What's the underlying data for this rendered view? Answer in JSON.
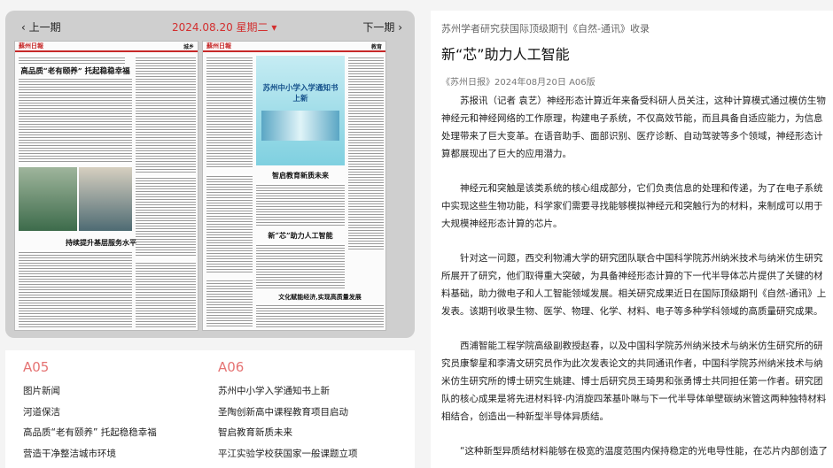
{
  "nav": {
    "prev": "上一期",
    "date": "2024.08.20 星期二 ▾",
    "next": "下一期",
    "prev_arrow": "‹",
    "next_arrow": "›"
  },
  "thumb_left": {
    "logo": "蘇州日報",
    "section": "城乡",
    "headline1": "高品质“老有颐养” 托起稳稳幸福",
    "headline2": "持续提升基层服务水平"
  },
  "thumb_right": {
    "logo": "蘇州日報",
    "section": "教育",
    "banner": "苏州中小学入学通知书上新",
    "headline1": "智启教育新质未来",
    "headline2": "新“芯”助力人工智能",
    "headline3": "文化赋能经济,实现高质量发展"
  },
  "issues": {
    "a05": {
      "page": "A05",
      "items": [
        "图片新闻",
        "河道保洁",
        "高品质“老有颐养” 托起稳稳幸福",
        "营造干净整洁城市环境"
      ]
    },
    "a06": {
      "page": "A06",
      "items": [
        "苏州中小学入学通知书上新",
        "圣陶创新高中课程教育项目启动",
        "智启教育新质未来",
        "平江实验学校获国家一般课题立项"
      ]
    }
  },
  "article": {
    "subtitle": "苏州学者研究获国际顶级期刊《自然-通讯》收录",
    "title": "新“芯”助力人工智能",
    "source": "《苏州日报》2024年08月20日 A06版",
    "paragraphs": [
      "苏报讯（记者 袁艺）神经形态计算近年来备受科研人员关注，这种计算模式通过模仿生物神经元和神经网络的工作原理，构建电子系统，不仅高效节能，而且具备自适应能力，为信息处理带来了巨大变革。在语音助手、面部识别、医疗诊断、自动驾驶等多个领域，神经形态计算都展现出了巨大的应用潜力。",
      "神经元和突触是该类系统的核心组成部分，它们负责信息的处理和传递，为了在电子系统中实现这些生物功能，科学家们需要寻找能够模拟神经元和突触行为的材料，来制成可以用于大规模神经形态计算的芯片。",
      "针对这一问题，西交利物浦大学的研究团队联合中国科学院苏州纳米技术与纳米仿生研究所展开了研究，他们取得重大突破，为具备神经形态计算的下一代半导体芯片提供了关键的材料基础，助力微电子和人工智能领域发展。相关研究成果近日在国际顶级期刊《自然-通讯》上发表。该期刊收录生物、医学、物理、化学、材料、电子等多种学科领域的高质量研究成果。",
      "西浦智能工程学院高级副教授赵春，以及中国科学院苏州纳米技术与纳米仿生研究所的研究员康黎星和李清文研究员作为此次发表论文的共同通讯作者，中国科学院苏州纳米技术与纳米仿生研究所的博士研究生姚建、博士后研究员王琦男和张勇博士共同担任第一作者。研究团队的核心成果是将先进材料锌-内消旋四苯基卟啉与下一代半导体单壁碳纳米管这两种独特材料相结合，创造出一种新型半导体异质结。",
      "“这种新型异质结材料能够在极宽的温度范围内保持稳定的光电导性能，在芯片内部创造了"
    ]
  }
}
